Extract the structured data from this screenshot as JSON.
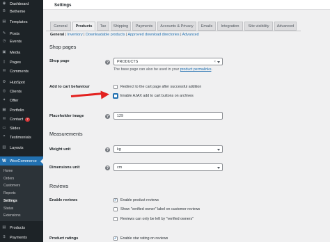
{
  "sidebar": {
    "items": [
      {
        "label": "Dashboard",
        "icon": "dashboard-icon",
        "glyph": "◉"
      },
      {
        "label": "Betheme",
        "icon": "betheme-icon",
        "glyph": "B"
      },
      {
        "label": "Templates",
        "icon": "templates-icon",
        "glyph": "▤"
      },
      {
        "label": "Posts",
        "icon": "pin-icon",
        "glyph": "✎"
      },
      {
        "label": "Events",
        "icon": "events-icon",
        "glyph": "◷"
      },
      {
        "label": "Media",
        "icon": "media-icon",
        "glyph": "▣"
      },
      {
        "label": "Pages",
        "icon": "pages-icon",
        "glyph": "▯"
      },
      {
        "label": "Comments",
        "icon": "comments-icon",
        "glyph": "✉"
      },
      {
        "label": "HubSpot",
        "icon": "hubspot-icon",
        "glyph": "⚙"
      },
      {
        "label": "Clients",
        "icon": "clients-icon",
        "glyph": "◎"
      },
      {
        "label": "Offer",
        "icon": "offer-icon",
        "glyph": "✦"
      },
      {
        "label": "Portfolio",
        "icon": "portfolio-icon",
        "glyph": "▦"
      },
      {
        "label": "Contact",
        "icon": "contact-icon",
        "glyph": "✉",
        "badge": "7"
      },
      {
        "label": "Slides",
        "icon": "slides-icon",
        "glyph": "▭"
      },
      {
        "label": "Testimonials",
        "icon": "testimonials-icon",
        "glyph": "❝"
      },
      {
        "label": "Layouts",
        "icon": "layouts-icon",
        "glyph": "▥"
      }
    ],
    "woocommerce": {
      "label": "WooCommerce",
      "glyph": "W"
    },
    "subitems": [
      "Home",
      "Orders",
      "Customers",
      "Reports",
      "Settings",
      "Status",
      "Extensions"
    ],
    "bottom_items": [
      {
        "label": "Products",
        "icon": "products-icon",
        "glyph": "▤"
      },
      {
        "label": "Payments",
        "icon": "payments-icon",
        "glyph": "$"
      }
    ]
  },
  "header": {
    "title": "Settings"
  },
  "tabs": [
    "General",
    "Products",
    "Tax",
    "Shipping",
    "Payments",
    "Accounts & Privacy",
    "Emails",
    "Integration",
    "Site visibility",
    "Advanced"
  ],
  "subnav": {
    "current": "General",
    "links": [
      "Inventory",
      "Downloadable products",
      "Approved download directories",
      "Advanced"
    ]
  },
  "sections": {
    "shop_pages": "Shop pages",
    "measurements": "Measurements",
    "reviews": "Reviews"
  },
  "fields": {
    "shop_page": {
      "label": "Shop page",
      "value": "PRODUCTS",
      "clear": "×",
      "desc_prefix": "The base page can also be used in your ",
      "desc_link": "product permalinks",
      "desc_suffix": "."
    },
    "add_to_cart": {
      "label": "Add to cart behaviour",
      "options": [
        {
          "label": "Redirect to the cart page after successful addition",
          "checked": false
        },
        {
          "label": "Enable AJAX add to cart buttons on archives",
          "checked": false
        }
      ]
    },
    "placeholder_image": {
      "label": "Placeholder image",
      "value": "129"
    },
    "weight_unit": {
      "label": "Weight unit",
      "value": "kg"
    },
    "dimensions_unit": {
      "label": "Dimensions unit",
      "value": "cm"
    },
    "enable_reviews": {
      "label": "Enable reviews",
      "options": [
        {
          "label": "Enable product reviews",
          "checked": true
        },
        {
          "label": "Show \"verified owner\" label on customer reviews",
          "checked": false
        },
        {
          "label": "Reviews can only be left by \"verified owners\"",
          "checked": false
        }
      ]
    },
    "product_ratings": {
      "label": "Product ratings",
      "options": [
        {
          "label": "Enable star rating on reviews",
          "checked": true
        }
      ]
    }
  },
  "glyphs": {
    "help": "?",
    "check": "✓"
  },
  "colors": {
    "accent": "#2271b1",
    "sidebar": "#1d2327",
    "arrow": "#e3211f"
  }
}
